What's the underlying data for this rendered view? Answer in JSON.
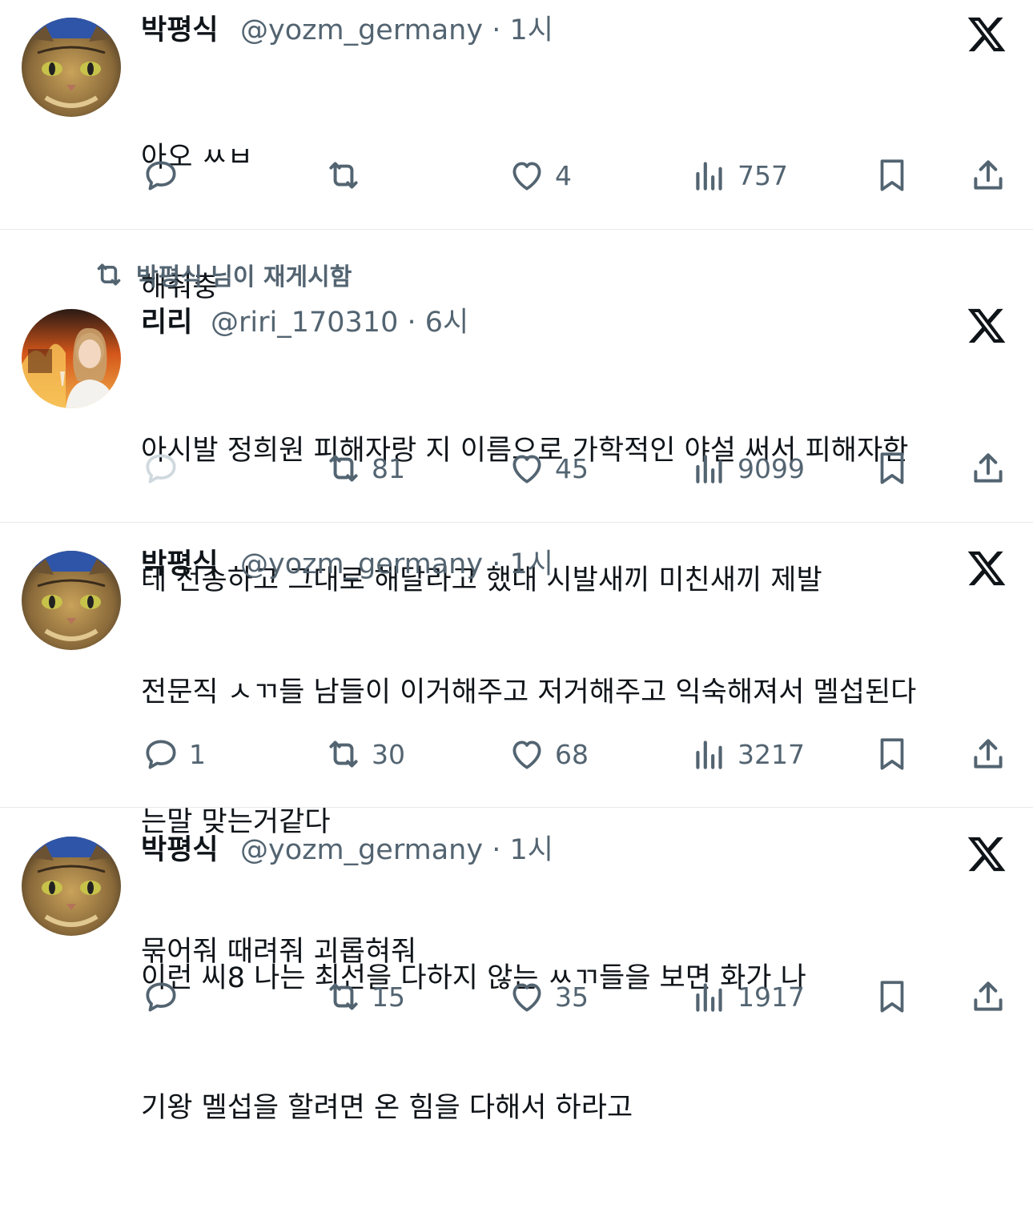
{
  "tweets": [
    {
      "display_name": "박평식",
      "handle": "@yozm_germany",
      "time": "1시",
      "lines": [
        "아오 ㅆㅂ",
        "해줘충"
      ],
      "replies": "",
      "retweets": "",
      "likes": "4",
      "views": "757"
    },
    {
      "display_name": "리리",
      "handle": "@riri_170310",
      "time": "6시",
      "lines": [
        "아시발 정희원 피해자랑 지 이름으로 가학적인 야설 써서 피해자한",
        "테 전송하고 그대로 해달라고 했대 시발새끼 미친새끼 제발"
      ],
      "replies": "",
      "retweets": "81",
      "likes": "45",
      "views": "9099"
    },
    {
      "display_name": "박평식",
      "handle": "@yozm_germany",
      "time": "1시",
      "lines": [
        "전문직 ㅅㄲ들 남들이 이거해주고 저거해주고 익숙해져서 멜섭된다",
        "는말 맞는거같다",
        "묶어줘 때려줘 괴롭혀줘"
      ],
      "replies": "1",
      "retweets": "30",
      "likes": "68",
      "views": "3217"
    },
    {
      "display_name": "박평식",
      "handle": "@yozm_germany",
      "time": "1시",
      "lines": [
        "이런 씨8 나는 최선을 다하지 않는 ㅆㄲ들을 보면 화가 나",
        "기왕 멜섭을 할려면 온 힘을 다해서 하라고"
      ],
      "replies": "",
      "retweets": "15",
      "likes": "35",
      "views": "1917"
    }
  ],
  "retweet_banner": "박평식 님이 재게시함",
  "colors": {
    "text": "#0f1419",
    "secondary": "#536471",
    "divider": "#e6e9ec"
  }
}
